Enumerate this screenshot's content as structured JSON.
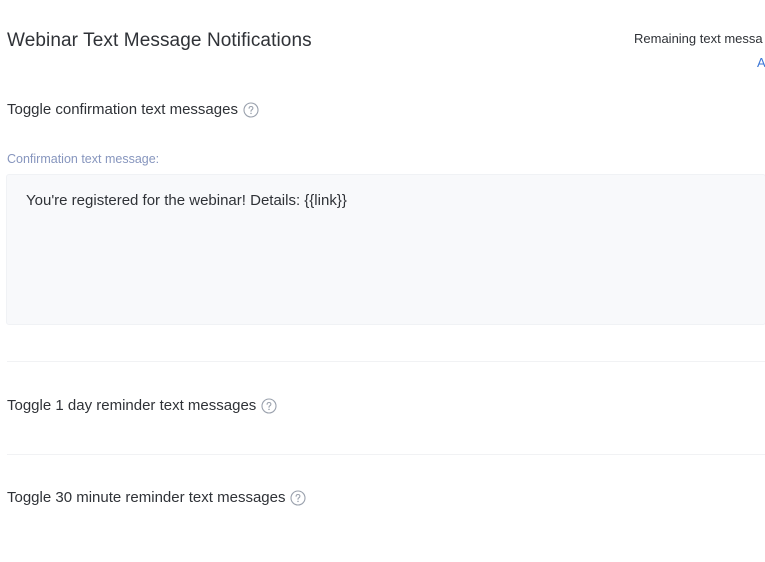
{
  "header": {
    "title": "Webinar Text Message Notifications",
    "remaining_text": "Remaining text messa",
    "remaining_link": "A"
  },
  "confirmation": {
    "toggle_label": "Toggle confirmation text messages",
    "field_label": "Confirmation text message:",
    "message_value": "You're registered for the webinar! Details: {{link}}"
  },
  "reminder_1_day": {
    "toggle_label": "Toggle 1 day reminder text messages"
  },
  "reminder_30_min": {
    "toggle_label": "Toggle 30 minute reminder text messages"
  },
  "icons": {
    "help": "question-circle-icon"
  },
  "colors": {
    "text": "#2f3237",
    "field_label": "#8796be",
    "link": "#3b76d6",
    "textarea_bg": "#f8f9fb",
    "icon": "#9aa1ad"
  }
}
